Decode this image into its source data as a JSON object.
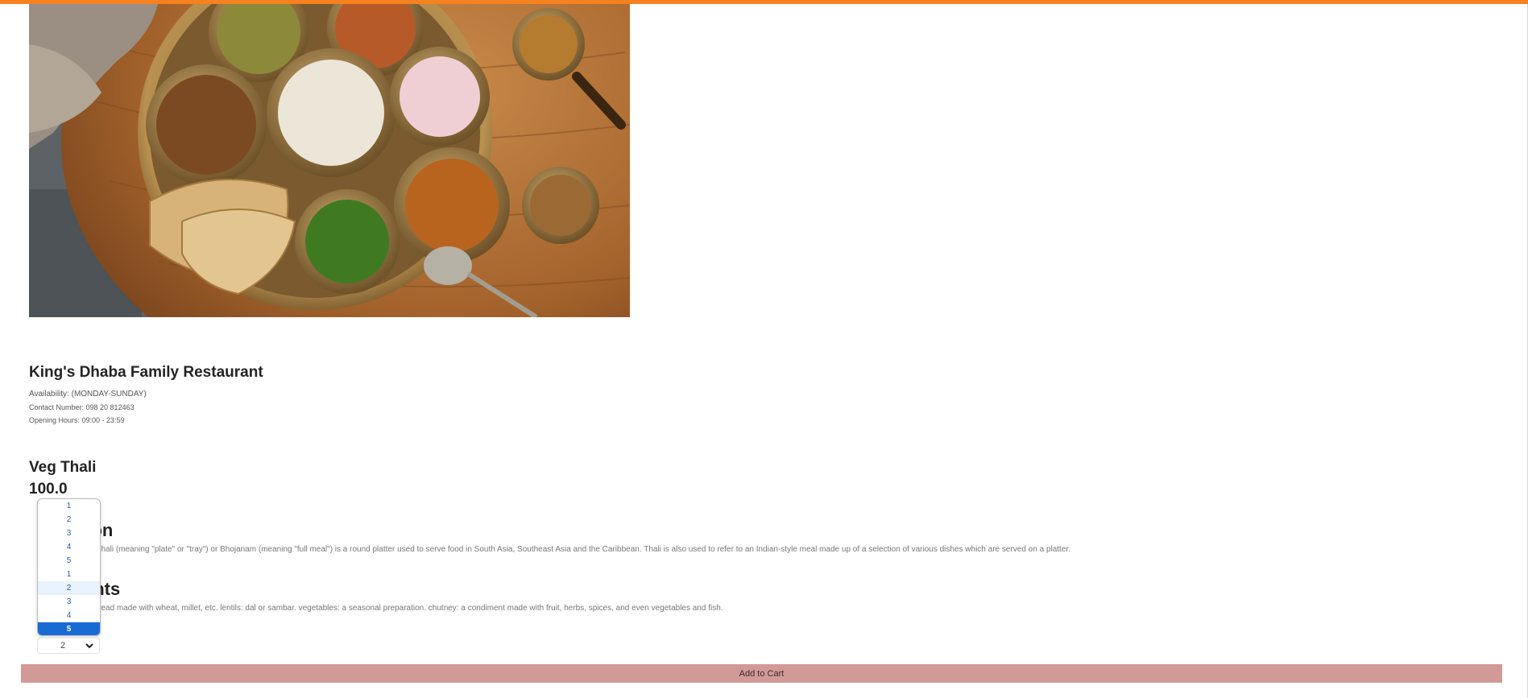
{
  "restaurant": {
    "name": "King's Dhaba Family Restaurant",
    "availability": "Availability: (MONDAY-SUNDAY)",
    "contact": "Contact Number: 098 20 812463",
    "hours": "Opening Hours: 09:00 - 23:59"
  },
  "dish": {
    "name": "Veg Thali",
    "price": "100.0"
  },
  "description": {
    "title": "Description",
    "title_visible": "tion",
    "text_visible": "ish Thali (meaning \"plate\" or \"tray\") or Bhojanam (meaning \"full meal\") is a round platter used to serve food in South Asia, Southeast Asia and the Caribbean. Thali is also used to refer to an Indian-style meal made up of a selection of various dishes which are served on a platter."
  },
  "ingredients": {
    "title_visible": "ents",
    "text_visible": "latbread made with wheat, millet, etc. lentils: dal or sambar. vegetables: a seasonal preparation. chutney: a condiment made with fruit, herbs, spices, and even vegetables and fish."
  },
  "quantity": {
    "selected": "2",
    "options": [
      "1",
      "2",
      "3",
      "4",
      "5",
      "1",
      "2",
      "3",
      "4",
      "5"
    ],
    "hover_index": 6,
    "selected_index": 9
  },
  "cart": {
    "button_label": "Add to Cart"
  },
  "colors": {
    "accent": "#f5811f",
    "cart_button": "#d29a96",
    "dropdown_selected": "#1a6ad6"
  },
  "hero_image": {
    "description_icon": "thali-platter-image"
  }
}
